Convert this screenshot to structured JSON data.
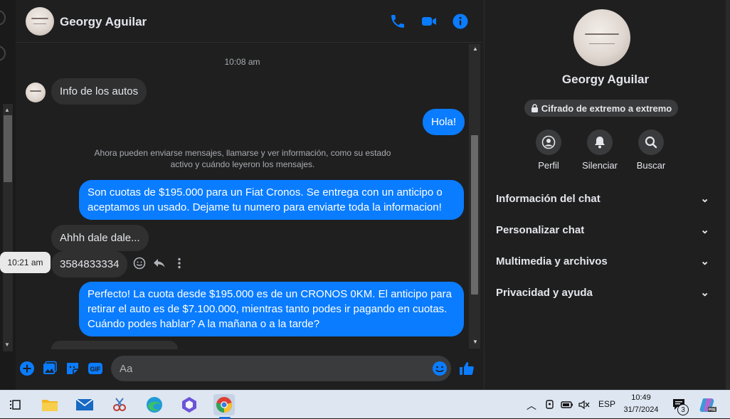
{
  "header": {
    "contact_name": "Georgy Aguilar",
    "call_label": "phone-icon",
    "video_label": "video-icon",
    "info_label": "info-icon"
  },
  "conversation": {
    "timestamp": "10:08 am",
    "messages": [
      {
        "direction": "in",
        "text": "Info de los autos"
      },
      {
        "direction": "out",
        "text": "Hola!"
      },
      {
        "direction": "system",
        "text": "Ahora pueden enviarse mensajes, llamarse y ver información, como su estado activo y cuándo leyeron los mensajes."
      },
      {
        "direction": "out",
        "text": "Son cuotas de $195.000 para un Fiat Cronos. Se entrega con un anticipo o aceptamos un usado. Dejame tu numero para enviarte toda la informacion!"
      },
      {
        "direction": "in",
        "text": "Ahhh dale dale..."
      },
      {
        "direction": "in",
        "text": "3584833334"
      },
      {
        "direction": "out",
        "text": "Perfecto! La cuota desde $195.000 es de un CRONOS 0KM. El anticipo para retirar el auto es de $7.100.000, mientras tanto podes ir pagando en cuotas. Cuándo podes hablar? A la mañana o a la tarde?"
      }
    ],
    "hover_tooltip": "10:21 am"
  },
  "composer": {
    "placeholder": "Aa"
  },
  "panel": {
    "name": "Georgy Aguilar",
    "encryption": "Cifrado de extremo a extremo",
    "actions": [
      {
        "label": "Perfil",
        "icon": "profile-icon"
      },
      {
        "label": "Silenciar",
        "icon": "bell-icon"
      },
      {
        "label": "Buscar",
        "icon": "search-icon"
      }
    ],
    "sections": [
      {
        "label": "Información del chat"
      },
      {
        "label": "Personalizar chat"
      },
      {
        "label": "Multimedia y archivos"
      },
      {
        "label": "Privacidad y ayuda"
      }
    ]
  },
  "taskbar": {
    "language": "ESP",
    "time": "10:49",
    "date": "31/7/2024",
    "notification_count": "3"
  },
  "colors": {
    "accent": "#0a7cff",
    "background": "#1f1f20",
    "incoming_bubble": "#303030",
    "taskbar": "#dde6f1"
  }
}
